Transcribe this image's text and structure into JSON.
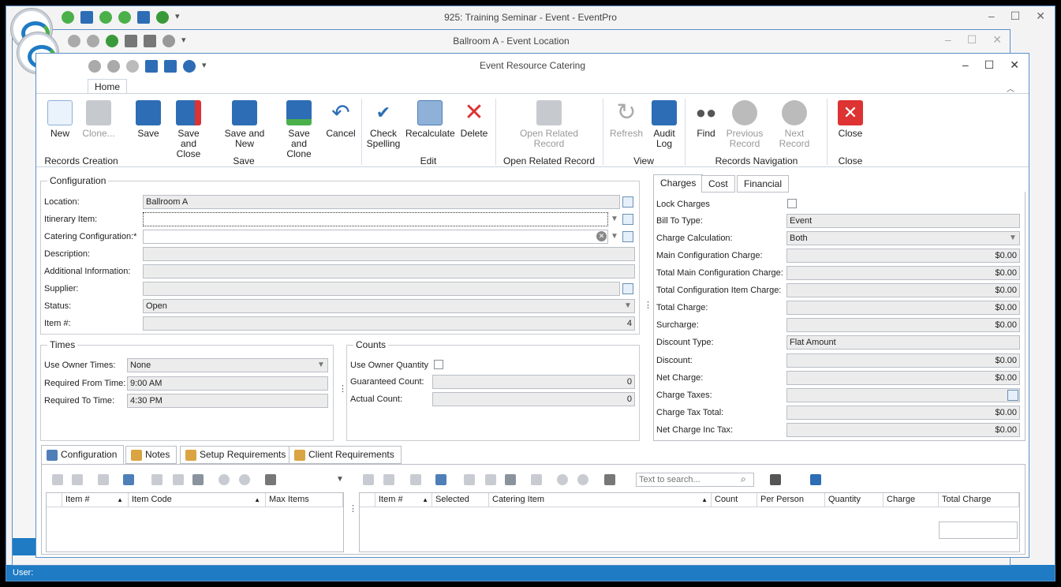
{
  "main_window": {
    "title": "925: Training Seminar - Event - EventPro",
    "status_label": "User:"
  },
  "location_window": {
    "title": "Ballroom A - Event Location"
  },
  "catering_window": {
    "title": "Event Resource Catering"
  },
  "ribbon": {
    "tab_home": "Home",
    "buttons": {
      "new": "New",
      "clone": "Clone...",
      "save": "Save",
      "save_close": "Save and Close",
      "save_new": "Save and New",
      "save_clone": "Save and Clone",
      "cancel": "Cancel",
      "check_spelling": "Check Spelling",
      "recalculate": "Recalculate",
      "delete": "Delete",
      "open_related": "Open Related Record",
      "refresh": "Refresh",
      "audit_log": "Audit Log",
      "find": "Find",
      "previous_record": "Previous Record",
      "next_record": "Next Record",
      "close": "Close"
    },
    "groups": {
      "records_creation": "Records Creation",
      "save": "Save",
      "edit": "Edit",
      "open_related": "Open Related Record",
      "view": "View",
      "records_navigation": "Records Navigation",
      "close": "Close"
    }
  },
  "configuration": {
    "legend": "Configuration",
    "location_label": "Location:",
    "location_value": "Ballroom A",
    "itinerary_label": "Itinerary Item:",
    "itinerary_value": "",
    "catering_config_label": "Catering Configuration:*",
    "catering_config_value": "",
    "description_label": "Description:",
    "description_value": "",
    "additional_label": "Additional Information:",
    "additional_value": "",
    "supplier_label": "Supplier:",
    "supplier_value": "",
    "status_label": "Status:",
    "status_value": "Open",
    "item_no_label": "Item #:",
    "item_no_value": "4"
  },
  "times": {
    "legend": "Times",
    "use_owner_label": "Use Owner Times:",
    "use_owner_value": "None",
    "from_label": "Required From Time:",
    "from_value": "9:00 AM",
    "to_label": "Required To Time:",
    "to_value": "4:30 PM"
  },
  "counts": {
    "legend": "Counts",
    "use_owner_qty_label": "Use Owner Quantity",
    "guaranteed_label": "Guaranteed Count:",
    "guaranteed_value": "0",
    "actual_label": "Actual Count:",
    "actual_value": "0"
  },
  "charges": {
    "tabs": [
      "Charges",
      "Cost",
      "Financial"
    ],
    "lock_label": "Lock Charges",
    "bill_to_label": "Bill To Type:",
    "bill_to_value": "Event",
    "calc_label": "Charge Calculation:",
    "calc_value": "Both",
    "main_conf_label": "Main Configuration Charge:",
    "main_conf_value": "$0.00",
    "total_main_label": "Total Main Configuration Charge:",
    "total_main_value": "$0.00",
    "total_item_label": "Total Configuration Item Charge:",
    "total_item_value": "$0.00",
    "total_charge_label": "Total Charge:",
    "total_charge_value": "$0.00",
    "surcharge_label": "Surcharge:",
    "surcharge_value": "$0.00",
    "discount_type_label": "Discount Type:",
    "discount_type_value": "Flat Amount",
    "discount_label": "Discount:",
    "discount_value": "$0.00",
    "net_label": "Net Charge:",
    "net_value": "$0.00",
    "taxes_label": "Charge Taxes:",
    "taxes_value": "",
    "tax_total_label": "Charge Tax Total:",
    "tax_total_value": "$0.00",
    "net_inc_label": "Net Charge Inc Tax:",
    "net_inc_value": "$0.00"
  },
  "bottom_tabs": [
    "Configuration",
    "Notes",
    "Setup Requirements",
    "Client Requirements"
  ],
  "search": {
    "placeholder": "Text to search..."
  },
  "left_grid": {
    "columns": [
      "Item #",
      "Item Code",
      "Max Items"
    ]
  },
  "right_grid": {
    "columns": [
      "Item #",
      "Selected",
      "Catering Item",
      "Count",
      "Per Person",
      "Quantity",
      "Charge",
      "Total Charge"
    ]
  }
}
